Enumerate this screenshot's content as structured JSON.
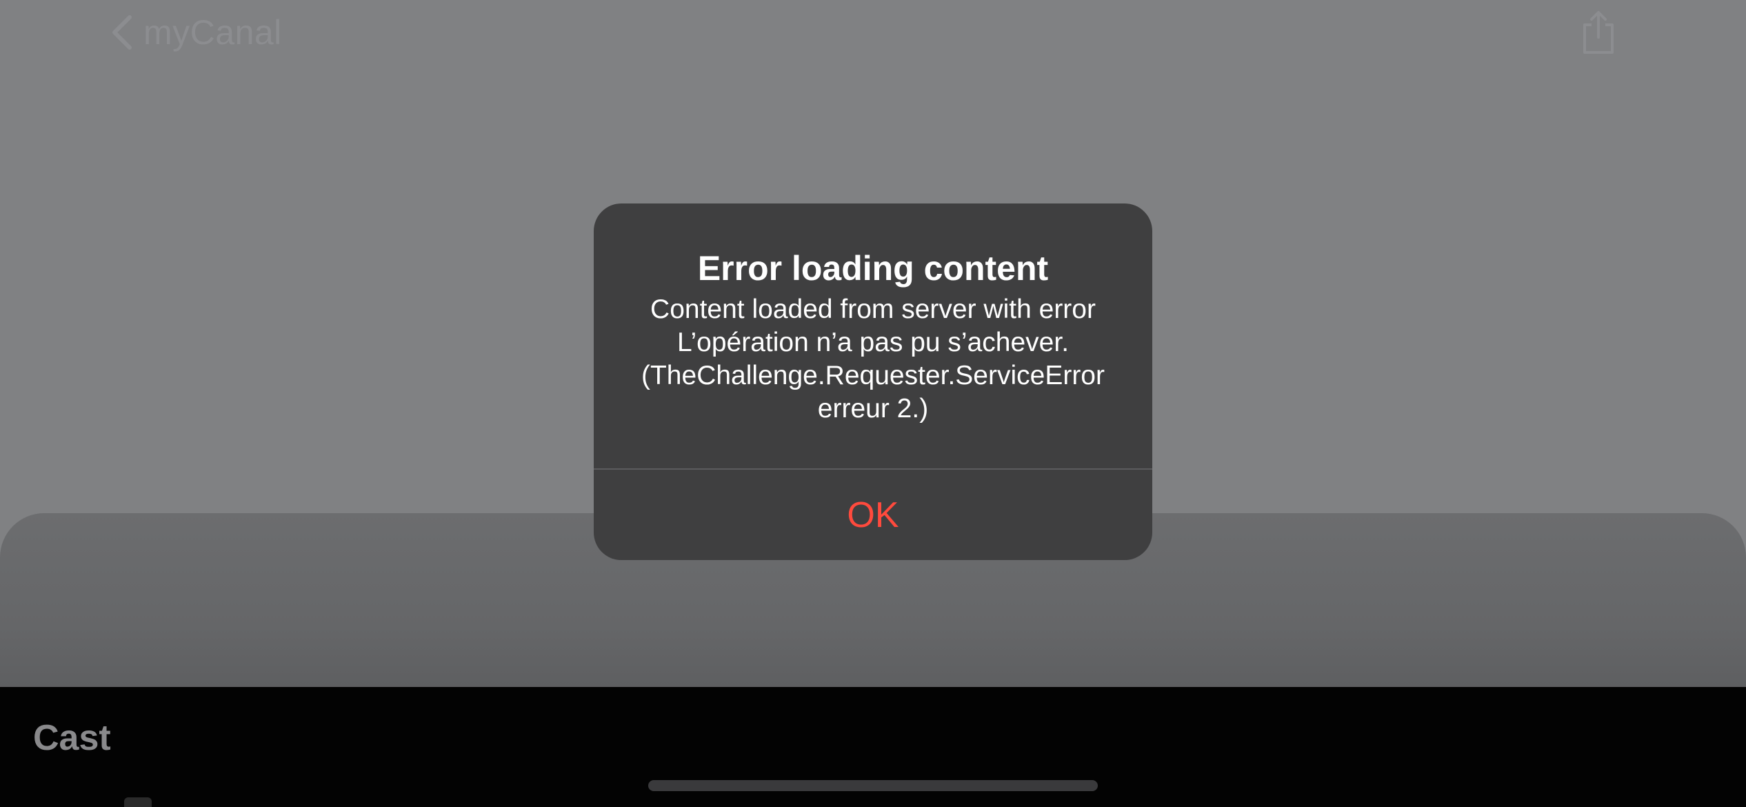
{
  "nav": {
    "back_label": "myCanal",
    "back_icon": "chevron-left-icon",
    "share_icon": "share-icon"
  },
  "content": {
    "section_title": "Cast"
  },
  "alert": {
    "title": "Error loading content",
    "message_lines": [
      "Content loaded from server with error",
      "L’opération n’a pas pu s’achever.",
      "(TheChallenge.Requester.ServiceError",
      "erreur 2.)"
    ],
    "ok_label": "OK"
  },
  "colors": {
    "alert_background": "#3f3f40",
    "action_red": "#ff4a3d",
    "dimmed_background": "#808183"
  }
}
